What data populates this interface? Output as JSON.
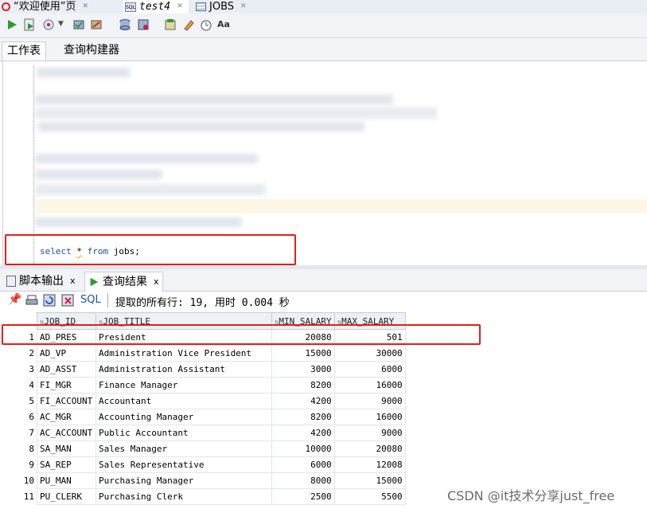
{
  "tabs": [
    {
      "label": "“欢迎使用”页",
      "icon": "oracle-icon",
      "active": false
    },
    {
      "label": "test4",
      "icon": "sql-icon",
      "active": true
    },
    {
      "label": "JOBS",
      "icon": "table-icon",
      "active": false
    }
  ],
  "worksheet_tabs": {
    "worksheet": "工作表",
    "query_builder": "查询构建器"
  },
  "editor": {
    "sql_select": "select",
    "sql_star": "*",
    "sql_from": "from",
    "sql_rest": "jobs;"
  },
  "result_tabs": {
    "script_output": "脚本输出",
    "query_result": "查询结果",
    "close": "x"
  },
  "result_toolbar": {
    "sql_label": "SQL",
    "status": "提取的所有行: 19, 用时 0.004 秒"
  },
  "columns": [
    "JOB_ID",
    "JOB_TITLE",
    "MIN_SALARY",
    "MAX_SALARY"
  ],
  "rows": [
    {
      "n": "1",
      "job_id": "AD_PRES",
      "job_title": "President",
      "min": "20080",
      "max": "501"
    },
    {
      "n": "2",
      "job_id": "AD_VP",
      "job_title": "Administration Vice President",
      "min": "15000",
      "max": "30000"
    },
    {
      "n": "3",
      "job_id": "AD_ASST",
      "job_title": "Administration Assistant",
      "min": "3000",
      "max": "6000"
    },
    {
      "n": "4",
      "job_id": "FI_MGR",
      "job_title": "Finance Manager",
      "min": "8200",
      "max": "16000"
    },
    {
      "n": "5",
      "job_id": "FI_ACCOUNT",
      "job_title": "Accountant",
      "min": "4200",
      "max": "9000"
    },
    {
      "n": "6",
      "job_id": "AC_MGR",
      "job_title": "Accounting Manager",
      "min": "8200",
      "max": "16000"
    },
    {
      "n": "7",
      "job_id": "AC_ACCOUNT",
      "job_title": "Public Accountant",
      "min": "4200",
      "max": "9000"
    },
    {
      "n": "8",
      "job_id": "SA_MAN",
      "job_title": "Sales Manager",
      "min": "10000",
      "max": "20080"
    },
    {
      "n": "9",
      "job_id": "SA_REP",
      "job_title": "Sales Representative",
      "min": "6000",
      "max": "12008"
    },
    {
      "n": "10",
      "job_id": "PU_MAN",
      "job_title": "Purchasing Manager",
      "min": "8000",
      "max": "15000"
    },
    {
      "n": "11",
      "job_id": "PU_CLERK",
      "job_title": "Purchasing Clerk",
      "min": "2500",
      "max": "5500"
    }
  ],
  "watermark": "CSDN @it技术分享just_free",
  "colors": {
    "highlight_red": "#e0201b",
    "keyword_blue": "#1f4fa8",
    "run_green": "#2e9b2e"
  }
}
